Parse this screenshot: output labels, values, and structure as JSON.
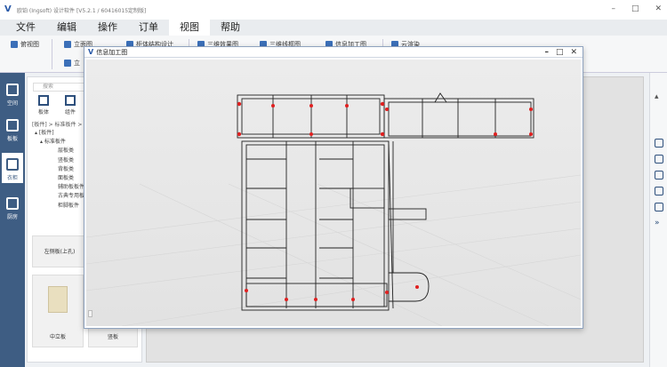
{
  "titlebar": {
    "title": "欧铂 (Ingsoft) 设计软件 [V5.2.1 / 60416015定制版]",
    "minimize": "–",
    "maximize": "□",
    "close": "✕"
  },
  "menu": {
    "items": [
      "文件",
      "编辑",
      "操作",
      "订单",
      "视图",
      "帮助"
    ],
    "active_index": 4
  },
  "ribbon": {
    "buttons": [
      "俯视图",
      "立面图",
      "柜体结构设计",
      "三维效果图",
      "三维线框图",
      "信息加工图",
      "云渲染",
      "立"
    ]
  },
  "leftbar": {
    "items": [
      "空间",
      "板板",
      "衣柜",
      "厨房"
    ],
    "active_index": 2
  },
  "panel": {
    "search_placeholder": "搜索",
    "tab1": "板体",
    "tab2": "组件",
    "breadcrumb": "[板件] > 标准板件 >",
    "tree_root": "[板件]",
    "tree_group": "标准板件",
    "tree_items": [
      "层板类",
      "竖板类",
      "背板类",
      "面板类",
      "辅助板板件",
      "古典专用板",
      "柜脚板件"
    ],
    "card1_label": "左侧板(上孔)",
    "card2_label": "中立板",
    "card3_label": "竖板"
  },
  "modal": {
    "title": "信息加工图",
    "min": "–",
    "max": "□",
    "close": "✕"
  },
  "colors": {
    "accent": "#2a5aa8",
    "leftbar": "#3e5d83",
    "hole_marker": "#e02020"
  }
}
